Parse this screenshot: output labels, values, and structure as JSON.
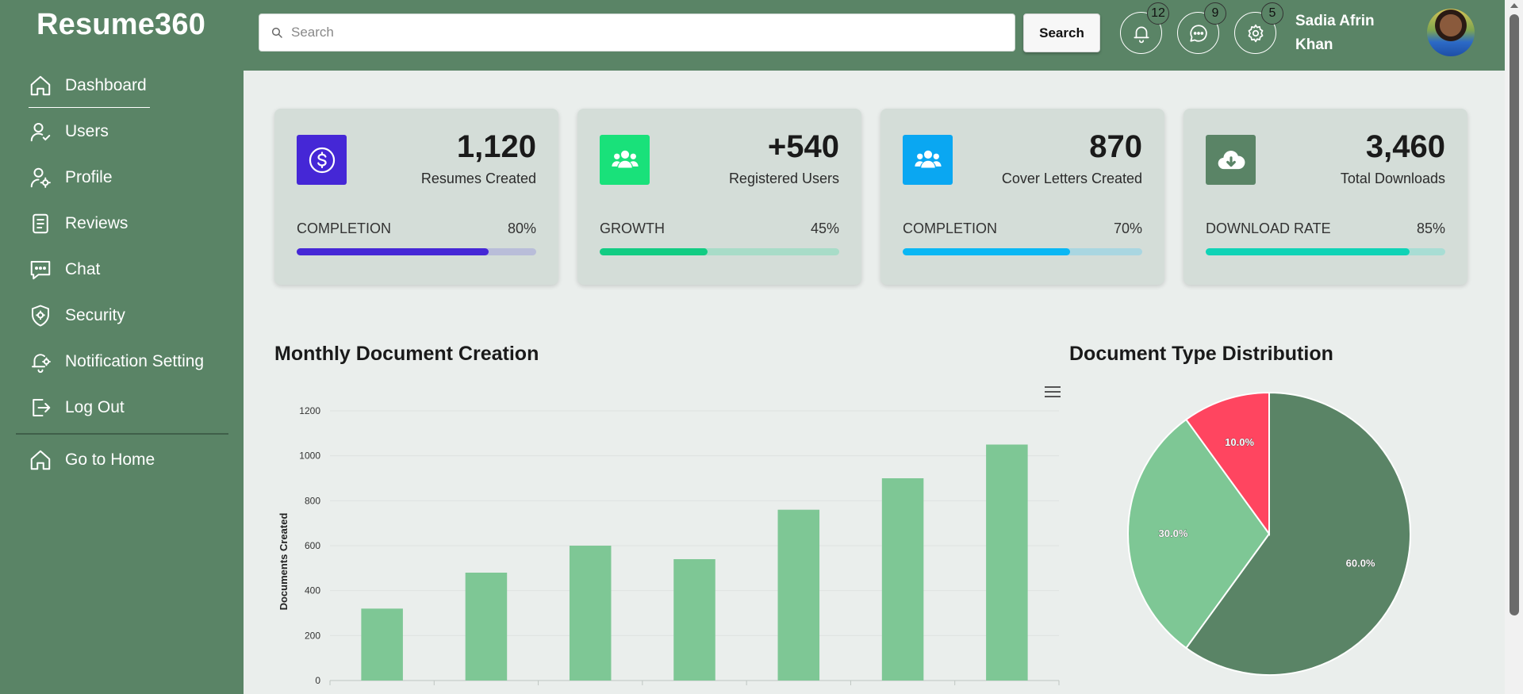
{
  "brand": "Resume360",
  "sidebar": {
    "items": [
      {
        "label": "Dashboard",
        "icon": "home-icon",
        "active": true
      },
      {
        "label": "Users",
        "icon": "user-check-icon"
      },
      {
        "label": "Profile",
        "icon": "user-gear-icon"
      },
      {
        "label": "Reviews",
        "icon": "document-icon"
      },
      {
        "label": "Chat",
        "icon": "chat-icon"
      },
      {
        "label": "Security",
        "icon": "shield-gear-icon"
      },
      {
        "label": "Notification Setting",
        "icon": "bell-settings-icon"
      },
      {
        "label": "Log Out",
        "icon": "logout-icon"
      }
    ],
    "home_link": {
      "label": "Go to Home",
      "icon": "home-icon"
    }
  },
  "header": {
    "search_placeholder": "Search",
    "search_button": "Search",
    "notifications_count": "12",
    "messages_count": "9",
    "settings_count": "5",
    "user_name": "Sadia Afrin Khan"
  },
  "cards": [
    {
      "value": "1,120",
      "label": "Resumes Created",
      "metric": "COMPLETION",
      "percent": "80%",
      "fill": 0.8,
      "icon": "dollar-icon",
      "icon_bg": "#4527d6",
      "bar_color": "#4527d6",
      "track_color": "#b9bdd9"
    },
    {
      "value": "+540",
      "label": "Registered Users",
      "metric": "GROWTH",
      "percent": "45%",
      "fill": 0.45,
      "icon": "users-icon",
      "icon_bg": "#19e17a",
      "bar_color": "#12cc83",
      "track_color": "#a8dcc8"
    },
    {
      "value": "870",
      "label": "Cover Letters Created",
      "metric": "COMPLETION",
      "percent": "70%",
      "fill": 0.7,
      "icon": "users-icon",
      "icon_bg": "#0aa7f2",
      "bar_color": "#0ab7f4",
      "track_color": "#a9d6e1"
    },
    {
      "value": "3,460",
      "label": "Total Downloads",
      "metric": "DOWNLOAD RATE",
      "percent": "85%",
      "fill": 0.85,
      "icon": "cloud-download-icon",
      "icon_bg": "#5a8466",
      "bar_color": "#0fd3b6",
      "track_color": "#a8ddd4"
    }
  ],
  "charts": {
    "bar_title": "Monthly Document Creation",
    "pie_title": "Document Type Distribution"
  },
  "chart_data": [
    {
      "type": "bar",
      "title": "Monthly Document Creation",
      "xlabel": "",
      "ylabel": "Documents Created",
      "ylim": [
        0,
        1200
      ],
      "yticks": [
        0,
        200,
        400,
        600,
        800,
        1000,
        1200
      ],
      "categories": [
        "",
        "",
        "",
        "",
        "",
        "",
        ""
      ],
      "values": [
        320,
        480,
        600,
        540,
        760,
        900,
        1050
      ],
      "color": "#7ec795",
      "grid": true
    },
    {
      "type": "pie",
      "title": "Document Type Distribution",
      "slices": [
        {
          "label": "60.0%",
          "value": 60,
          "color": "#5a8466"
        },
        {
          "label": "30.0%",
          "value": 30,
          "color": "#7ec795"
        },
        {
          "label": "10.0%",
          "value": 10,
          "color": "#ff4560"
        }
      ]
    }
  ]
}
